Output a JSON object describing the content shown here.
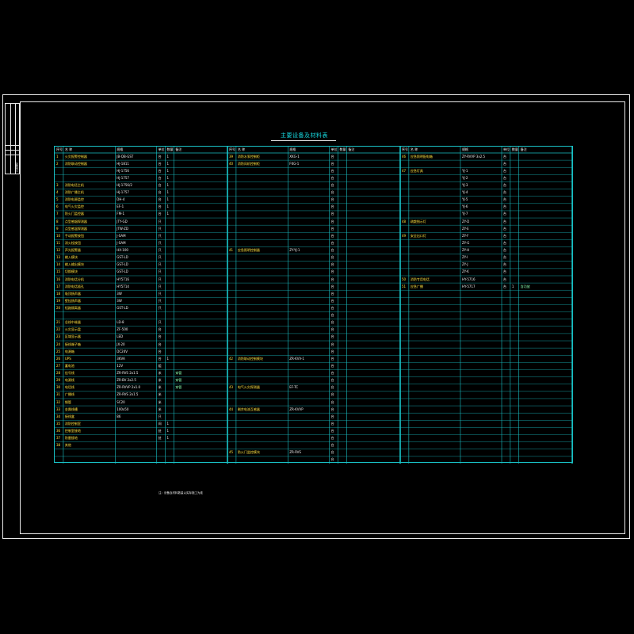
{
  "sheet": {
    "title": "主要设备及材料表",
    "footnote": "注：设备及材料数量以实际施工为准",
    "titleblock_label": "会签栏"
  },
  "table": {
    "headers": [
      "序号",
      "名 称",
      "规格",
      "单位",
      "数量",
      "备注"
    ],
    "panels": [
      {
        "rows": [
          [
            "1",
            "火灾报警控制器",
            "JB-QB-GST",
            "台",
            "1",
            ""
          ],
          [
            "2",
            "消防联动控制器",
            "HJ-1811",
            "台",
            "1",
            ""
          ],
          [
            "",
            "",
            "HJ-1756",
            "台",
            "1",
            ""
          ],
          [
            "",
            "",
            "HJ-1757",
            "台",
            "1",
            ""
          ],
          [
            "3",
            "消防电话主机",
            "HJ-1756/2",
            "台",
            "1",
            ""
          ],
          [
            "4",
            "消防广播主机",
            "HJ-1757",
            "台",
            "1",
            ""
          ],
          [
            "5",
            "消防电源监控",
            "DH-4",
            "台",
            "1",
            ""
          ],
          [
            "6",
            "电气火灾监控",
            "EF-1",
            "台",
            "1",
            ""
          ],
          [
            "7",
            "防火门监控器",
            "FM-1",
            "台",
            "1",
            ""
          ],
          [
            "8",
            "点型感烟探测器",
            "JTY-GD",
            "只",
            "",
            ""
          ],
          [
            "9",
            "点型感温探测器",
            "JTW-ZD",
            "只",
            "",
            ""
          ],
          [
            "10",
            "手动报警按钮",
            "J-SAM",
            "只",
            "",
            ""
          ],
          [
            "11",
            "消火栓按钮",
            "J-SAM",
            "只",
            "",
            ""
          ],
          [
            "12",
            "声光报警器",
            "HX-100",
            "只",
            "",
            ""
          ],
          [
            "13",
            "输入模块",
            "GST-LD",
            "只",
            "",
            ""
          ],
          [
            "14",
            "输入输出模块",
            "GST-LD",
            "只",
            "",
            ""
          ],
          [
            "15",
            "切换模块",
            "GST-LD",
            "只",
            "",
            ""
          ],
          [
            "16",
            "消防电话分机",
            "HY5716",
            "只",
            "",
            ""
          ],
          [
            "17",
            "消防电话插孔",
            "HY5714",
            "只",
            "",
            ""
          ],
          [
            "18",
            "吸顶扬声器",
            "3W",
            "只",
            "",
            ""
          ],
          [
            "19",
            "壁挂扬声器",
            "3W",
            "只",
            "",
            ""
          ],
          [
            "20",
            "短路隔离器",
            "GST-LD",
            "只",
            "",
            ""
          ],
          [
            "",
            "",
            "",
            "",
            "",
            ""
          ],
          [
            "21",
            "总线中继器",
            "LD-8",
            "只",
            "",
            ""
          ],
          [
            "22",
            "火灾显示盘",
            "ZF-500",
            "台",
            "",
            ""
          ],
          [
            "23",
            "区域显示器",
            "LED",
            "台",
            "",
            ""
          ],
          [
            "24",
            "接线端子箱",
            "JX-20",
            "台",
            "",
            ""
          ],
          [
            "25",
            "电源箱",
            "DC24V",
            "台",
            "",
            ""
          ],
          [
            "26",
            "UPS",
            "3KVA",
            "台",
            "1",
            ""
          ],
          [
            "27",
            "蓄电池",
            "12V",
            "组",
            "",
            ""
          ],
          [
            "28",
            "信号线",
            "ZR-RVS 2x1.5",
            "米",
            "",
            "穿管"
          ],
          [
            "29",
            "电源线",
            "ZR-BV 2x2.5",
            "米",
            "",
            "穿管"
          ],
          [
            "30",
            "电话线",
            "ZR-RVVP 2x1.0",
            "米",
            "",
            "穿管"
          ],
          [
            "31",
            "广播线",
            "ZR-RVS 2x1.5",
            "米",
            "",
            ""
          ],
          [
            "32",
            "钢管",
            "SC20",
            "米",
            "",
            ""
          ],
          [
            "33",
            "金属线槽",
            "100x50",
            "米",
            "",
            ""
          ],
          [
            "34",
            "接线盒",
            "86",
            "只",
            "",
            ""
          ],
          [
            "35",
            "消防控制室",
            "",
            "间",
            "1",
            ""
          ],
          [
            "36",
            "控制室接地",
            "",
            "处",
            "1",
            ""
          ],
          [
            "37",
            "防雷接地",
            "",
            "处",
            "1",
            ""
          ],
          [
            "38",
            "其他",
            "",
            "",
            "",
            ""
          ],
          [
            "",
            "",
            "",
            "",
            "",
            ""
          ],
          [
            "",
            "",
            "",
            "",
            "",
            ""
          ]
        ]
      },
      {
        "rows": [
          [
            "39",
            "消防水泵控制柜",
            "XKG-1",
            "台",
            "",
            ""
          ],
          [
            "40",
            "消防风机控制柜",
            "FKG-1",
            "台",
            "",
            ""
          ],
          [
            "",
            "",
            "",
            "台",
            "",
            ""
          ],
          [
            "",
            "",
            "",
            "台",
            "",
            ""
          ],
          [
            "",
            "",
            "",
            "台",
            "",
            ""
          ],
          [
            "",
            "",
            "",
            "台",
            "",
            ""
          ],
          [
            "",
            "",
            "",
            "台",
            "",
            ""
          ],
          [
            "",
            "",
            "",
            "台",
            "",
            ""
          ],
          [
            "",
            "",
            "",
            "台",
            "",
            ""
          ],
          [
            "",
            "",
            "",
            "台",
            "",
            ""
          ],
          [
            "",
            "",
            "",
            "台",
            "",
            ""
          ],
          [
            "",
            "",
            "",
            "台",
            "",
            ""
          ],
          [
            "",
            "",
            "",
            "台",
            "",
            ""
          ],
          [
            "41",
            "应急照明控制器",
            "ZY-YJ-1",
            "台",
            "",
            ""
          ],
          [
            "",
            "",
            "",
            "台",
            "",
            ""
          ],
          [
            "",
            "",
            "",
            "台",
            "",
            ""
          ],
          [
            "",
            "",
            "",
            "台",
            "",
            ""
          ],
          [
            "",
            "",
            "",
            "台",
            "",
            ""
          ],
          [
            "",
            "",
            "",
            "台",
            "",
            ""
          ],
          [
            "",
            "",
            "",
            "台",
            "",
            ""
          ],
          [
            "",
            "",
            "",
            "台",
            "",
            ""
          ],
          [
            "",
            "",
            "",
            "台",
            "",
            ""
          ],
          [
            "",
            "",
            "",
            "台",
            "",
            ""
          ],
          [
            "",
            "",
            "",
            "台",
            "",
            ""
          ],
          [
            "",
            "",
            "",
            "台",
            "",
            ""
          ],
          [
            "",
            "",
            "",
            "台",
            "",
            ""
          ],
          [
            "",
            "",
            "",
            "台",
            "",
            ""
          ],
          [
            "",
            "",
            "",
            "台",
            "",
            ""
          ],
          [
            "42",
            "消防联动控制模块",
            "ZR-KVV-1",
            "台",
            "",
            ""
          ],
          [
            "",
            "",
            "",
            "台",
            "",
            ""
          ],
          [
            "",
            "",
            "",
            "台",
            "",
            ""
          ],
          [
            "",
            "",
            "",
            "台",
            "",
            ""
          ],
          [
            "43",
            "电气火灾探测器",
            "EF-TC",
            "台",
            "",
            ""
          ],
          [
            "",
            "",
            "",
            "台",
            "",
            ""
          ],
          [
            "",
            "",
            "",
            "台",
            "",
            ""
          ],
          [
            "44",
            "剩余电流互感器",
            "ZR-KVVP",
            "台",
            "",
            ""
          ],
          [
            "",
            "",
            "",
            "台",
            "",
            ""
          ],
          [
            "",
            "",
            "",
            "台",
            "",
            ""
          ],
          [
            "",
            "",
            "",
            "台",
            "",
            ""
          ],
          [
            "",
            "",
            "",
            "台",
            "",
            ""
          ],
          [
            "",
            "",
            "",
            "台",
            "",
            ""
          ],
          [
            "45",
            "防火门监控模块",
            "ZR-RVS",
            "台",
            "",
            ""
          ],
          [
            "",
            "",
            "",
            "台",
            "",
            ""
          ]
        ]
      },
      {
        "rows": [
          [
            "46",
            "应急照明配电箱",
            "ZY-RVVP 3x2.5",
            "台",
            "",
            ""
          ],
          [
            "",
            "",
            "",
            "台",
            "",
            ""
          ],
          [
            "47",
            "应急灯具",
            "YJ-1",
            "台",
            "",
            ""
          ],
          [
            "",
            "",
            "YJ-2",
            "台",
            "",
            ""
          ],
          [
            "",
            "",
            "YJ-3",
            "台",
            "",
            ""
          ],
          [
            "",
            "",
            "YJ-4",
            "台",
            "",
            ""
          ],
          [
            "",
            "",
            "YJ-5",
            "台",
            "",
            ""
          ],
          [
            "",
            "",
            "YJ-6",
            "台",
            "",
            ""
          ],
          [
            "",
            "",
            "YJ-7",
            "台",
            "",
            ""
          ],
          [
            "48",
            "疏散指示灯",
            "ZY-D",
            "台",
            "",
            ""
          ],
          [
            "",
            "",
            "ZY-E",
            "台",
            "",
            ""
          ],
          [
            "49",
            "安全出口灯",
            "ZY-F",
            "台",
            "",
            ""
          ],
          [
            "",
            "",
            "ZY-G",
            "台",
            "",
            ""
          ],
          [
            "",
            "",
            "ZY-H",
            "台",
            "",
            ""
          ],
          [
            "",
            "",
            "ZY-I",
            "台",
            "",
            ""
          ],
          [
            "",
            "",
            "ZY-J",
            "台",
            "",
            ""
          ],
          [
            "",
            "",
            "ZY-K",
            "台",
            "",
            ""
          ],
          [
            "50",
            "消防专用电话",
            "HY-5716",
            "台",
            "",
            ""
          ],
          [
            "51",
            "应急广播",
            "HY-5717",
            "台",
            "1",
            "含功放"
          ],
          [
            "",
            "",
            "",
            "",
            "",
            ""
          ],
          [
            "",
            "",
            "",
            "",
            "",
            ""
          ],
          [
            "",
            "",
            "",
            "",
            "",
            ""
          ],
          [
            "",
            "",
            "",
            "",
            "",
            ""
          ],
          [
            "",
            "",
            "",
            "",
            "",
            ""
          ],
          [
            "",
            "",
            "",
            "",
            "",
            ""
          ],
          [
            "",
            "",
            "",
            "",
            "",
            ""
          ],
          [
            "",
            "",
            "",
            "",
            "",
            ""
          ],
          [
            "",
            "",
            "",
            "",
            "",
            ""
          ],
          [
            "",
            "",
            "",
            "",
            "",
            ""
          ],
          [
            "",
            "",
            "",
            "",
            "",
            ""
          ],
          [
            "",
            "",
            "",
            "",
            "",
            ""
          ],
          [
            "",
            "",
            "",
            "",
            "",
            ""
          ],
          [
            "",
            "",
            "",
            "",
            "",
            ""
          ],
          [
            "",
            "",
            "",
            "",
            "",
            ""
          ],
          [
            "",
            "",
            "",
            "",
            "",
            ""
          ],
          [
            "",
            "",
            "",
            "",
            "",
            ""
          ],
          [
            "",
            "",
            "",
            "",
            "",
            ""
          ],
          [
            "",
            "",
            "",
            "",
            "",
            ""
          ],
          [
            "",
            "",
            "",
            "",
            "",
            ""
          ],
          [
            "",
            "",
            "",
            "",
            "",
            ""
          ],
          [
            "",
            "",
            "",
            "",
            "",
            ""
          ],
          [
            "",
            "",
            "",
            "",
            "",
            ""
          ],
          [
            "",
            "",
            "",
            "",
            "",
            ""
          ]
        ]
      }
    ]
  },
  "colors": {
    "grid": "#19c2c6",
    "frame": "#e8e8e8",
    "title": "#16d9e0",
    "text_yellow": "#ffe040",
    "text_white": "#f2f2f2"
  }
}
